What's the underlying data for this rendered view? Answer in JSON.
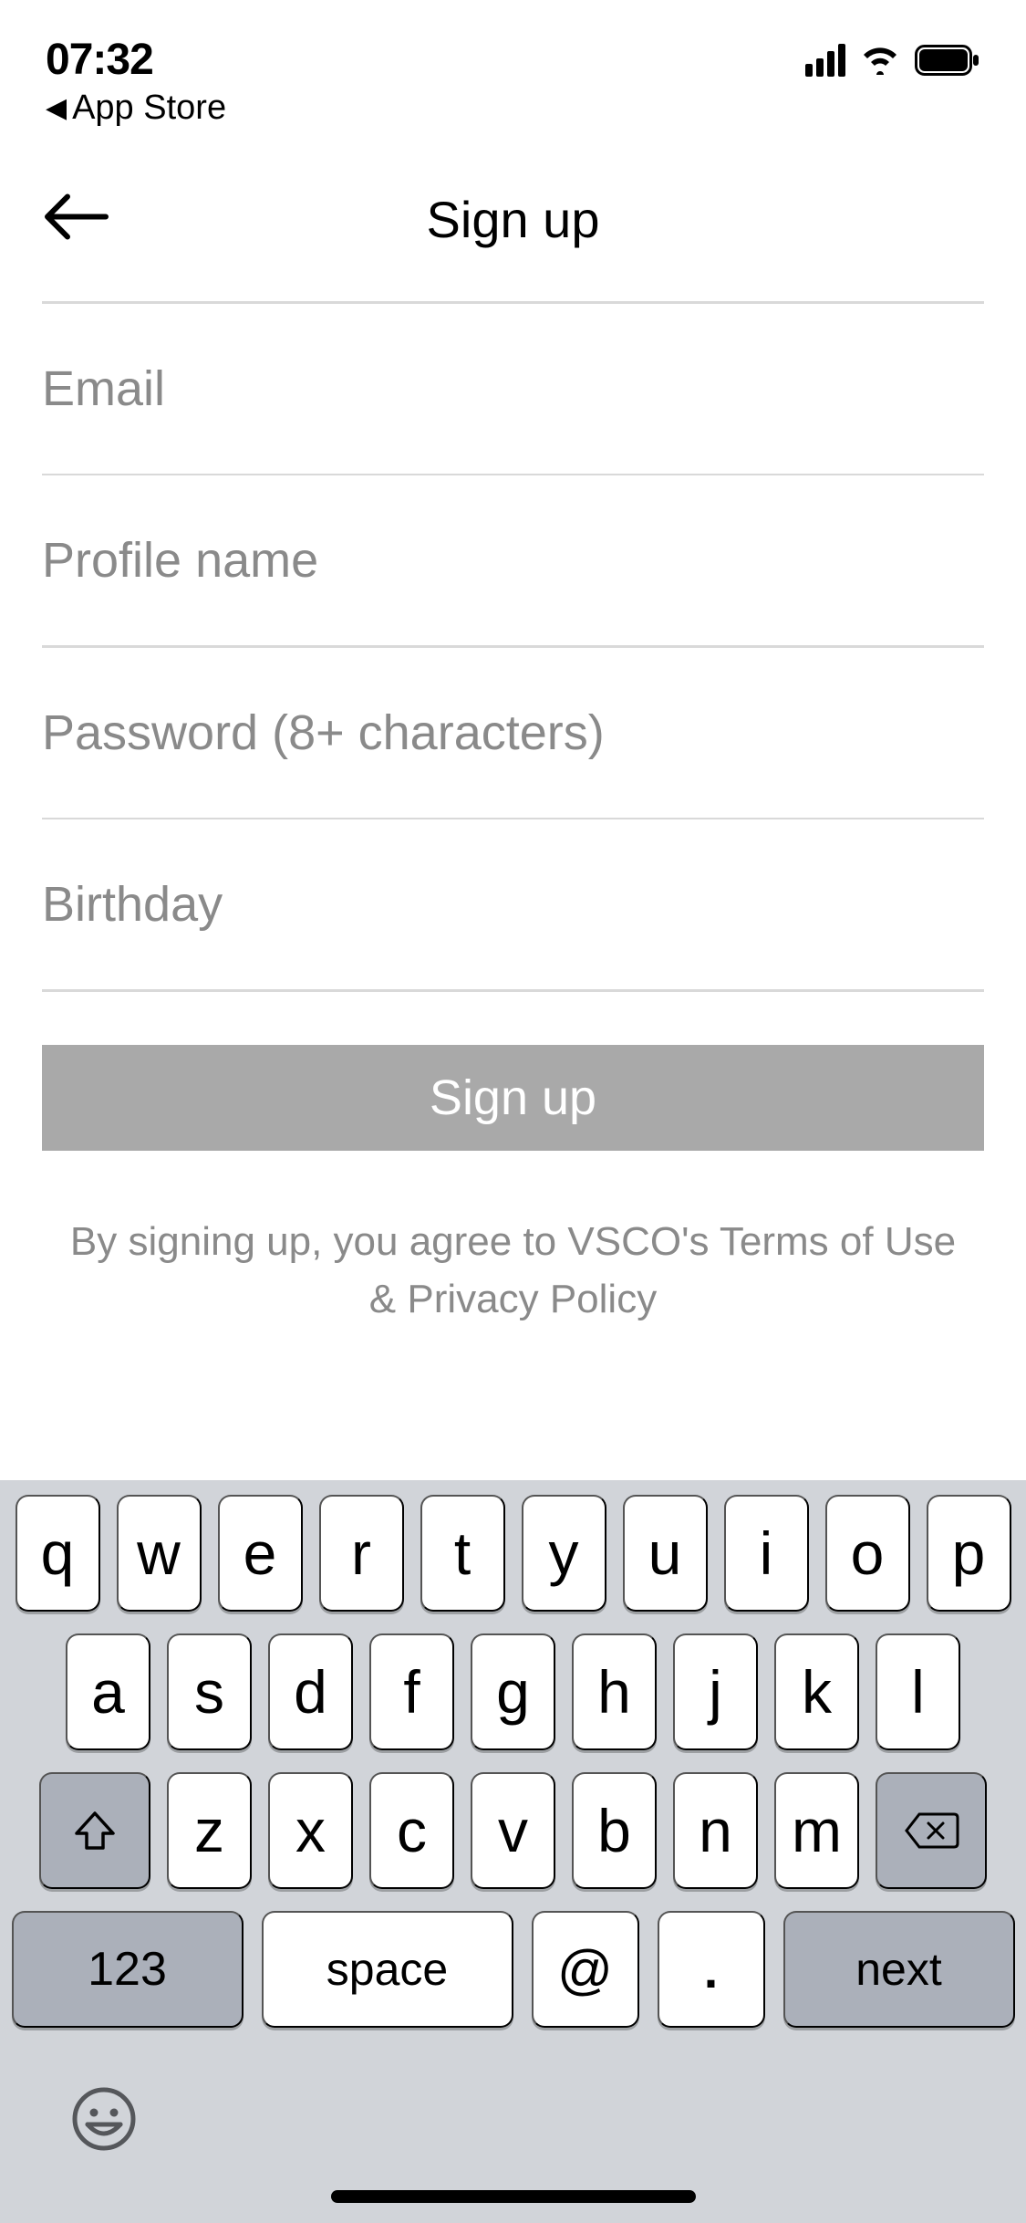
{
  "status": {
    "time": "07:32",
    "breadcrumb": "App Store"
  },
  "nav": {
    "title": "Sign up"
  },
  "form": {
    "email_placeholder": "Email",
    "profile_placeholder": "Profile name",
    "password_placeholder": "Password (8+ characters)",
    "birthday_placeholder": "Birthday",
    "submit_label": "Sign up"
  },
  "legal": {
    "prefix": "By signing up, you agree to VSCO's ",
    "terms": "Terms of Use",
    "amp": " & ",
    "privacy": "Privacy Policy"
  },
  "keyboard": {
    "row1": [
      "q",
      "w",
      "e",
      "r",
      "t",
      "y",
      "u",
      "i",
      "o",
      "p"
    ],
    "row2": [
      "a",
      "s",
      "d",
      "f",
      "g",
      "h",
      "j",
      "k",
      "l"
    ],
    "row3": [
      "z",
      "x",
      "c",
      "v",
      "b",
      "n",
      "m"
    ],
    "num": "123",
    "space": "space",
    "at": "@",
    "dot": ".",
    "next": "next"
  }
}
